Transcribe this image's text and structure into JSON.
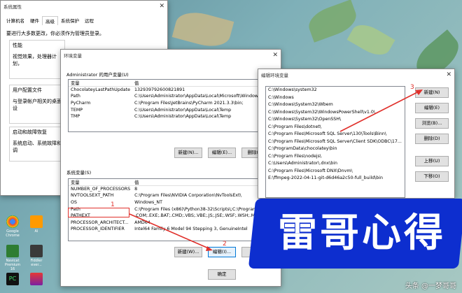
{
  "sysprops": {
    "title": "系统属性",
    "tabs": [
      "计算机名",
      "硬件",
      "高级",
      "系统保护",
      "远程"
    ],
    "note": "要进行大多数更改，你必须作为管理员登录。",
    "perf_title": "性能",
    "perf_text": "视觉效果，处理器计划，",
    "profile_title": "用户配置文件",
    "profile_text": "与登录帐户相关的桌面设",
    "startup_title": "启动和故障恢复",
    "startup_text": "系统启动、系统故障和调"
  },
  "envvars": {
    "title": "环境变量",
    "user_section": "Administrator 的用户变量(U)",
    "col_var": "变量",
    "col_val": "值",
    "user_vars": [
      [
        "ChocolateyLastPathUpdate",
        "132939792600821891"
      ],
      [
        "Path",
        "C:\\Users\\Administrator\\AppData\\Local\\Microsoft\\WindowsA..."
      ],
      [
        "PyCharm",
        "C:\\Program Files\\JetBrains\\PyCharm 2021.3.3\\bin;"
      ],
      [
        "TEMP",
        "C:\\Users\\Administrator\\AppData\\Local\\Temp"
      ],
      [
        "TMP",
        "C:\\Users\\Administrator\\AppData\\Local\\Temp"
      ]
    ],
    "user_buttons": [
      "新建(N)...",
      "编辑(E)...",
      "删除(D)"
    ],
    "sys_section": "系统变量(S)",
    "sys_vars": [
      [
        "NUMBER_OF_PROCESSORS",
        "8"
      ],
      [
        "NVTOOLSEXT_PATH",
        "C:\\Program Files\\NVIDIA Corporation\\NvToolsExt\\"
      ],
      [
        "OS",
        "Windows_NT"
      ],
      [
        "Path",
        "C:\\Program Files (x86)\\Python38-32\\Scripts\\;C:\\Program"
      ],
      [
        "PATHEXT",
        ".COM;.EXE;.BAT;.CMD;.VBS;.VBE;.JS;.JSE;.WSF;.WSH;.MSC;"
      ],
      [
        "PROCESSOR_ARCHITECT...",
        "AMD64"
      ],
      [
        "PROCESSOR_IDENTIFIER",
        "Intel64 Family 6 Model 94 Stepping 3, GenuineIntel"
      ]
    ],
    "sys_buttons": [
      "新建(W)...",
      "编辑(I)...",
      "删除"
    ],
    "ok": "确定"
  },
  "editenv": {
    "title": "编辑环境变量",
    "entries": [
      "C:\\Windows\\system32",
      "C:\\Windows",
      "C:\\Windows\\System32\\Wbem",
      "C:\\Windows\\System32\\WindowsPowerShell\\v1.0\\",
      "C:\\Windows\\System32\\OpenSSH\\",
      "C:\\Program Files\\dotnet\\",
      "C:\\Program Files\\Microsoft SQL Server\\130\\Tools\\Binn\\",
      "C:\\Program Files\\Microsoft SQL Server\\Client SDK\\ODBC\\17...",
      "C:\\ProgramData\\chocolatey\\bin",
      "C:\\Program Files\\nodejs\\",
      "C:\\Users\\Administrator\\.dnx\\bin",
      "C:\\Program Files\\Microsoft DNX\\Dnvm\\",
      "E:\\ffmpeg-2022-04-11-git-d6d46a2c50-full_build\\bin"
    ],
    "buttons": [
      "新建(N)",
      "编辑(E)",
      "浏览(B)...",
      "删除(D)",
      "上移(U)",
      "下移(O)"
    ]
  },
  "annotations": [
    "1",
    "2",
    "3"
  ],
  "desktop_icons": [
    "Google Chrome",
    "AI",
    "Navicat Premium 16",
    "Fiddler ever...",
    "PC",
    "WPS"
  ],
  "banner": "雷哥心得",
  "watermark": "头条 @一梦哥哥",
  "colors": {
    "annotation": "#e0302b",
    "banner": "#0d2ecf",
    "selection": "#cce8ff"
  }
}
